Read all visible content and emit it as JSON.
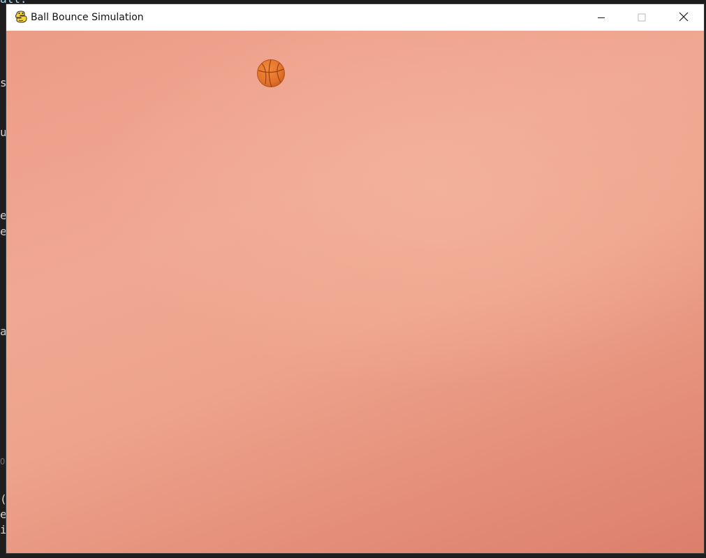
{
  "window": {
    "title": "Ball Bounce Simulation",
    "app_icon": "pygame-snake-icon",
    "controls": {
      "minimize_icon": "minimize-icon",
      "maximize_icon": "maximize-icon",
      "close_icon": "close-icon"
    }
  },
  "canvas": {
    "background_colors": [
      "#ec9c87",
      "#f0a893",
      "#dc7f6c"
    ],
    "ball": {
      "icon": "basketball-icon",
      "color": "#e8762a"
    }
  },
  "background_editor": {
    "fragments": [
      {
        "text": "all."
      },
      {
        "text": "s"
      },
      {
        "text": "u"
      },
      {
        "text": "e"
      },
      {
        "text": "e"
      },
      {
        "text": "a"
      },
      {
        "text": "Ou"
      },
      {
        "text": "("
      },
      {
        "text": "e"
      },
      {
        "text": "i"
      }
    ]
  }
}
